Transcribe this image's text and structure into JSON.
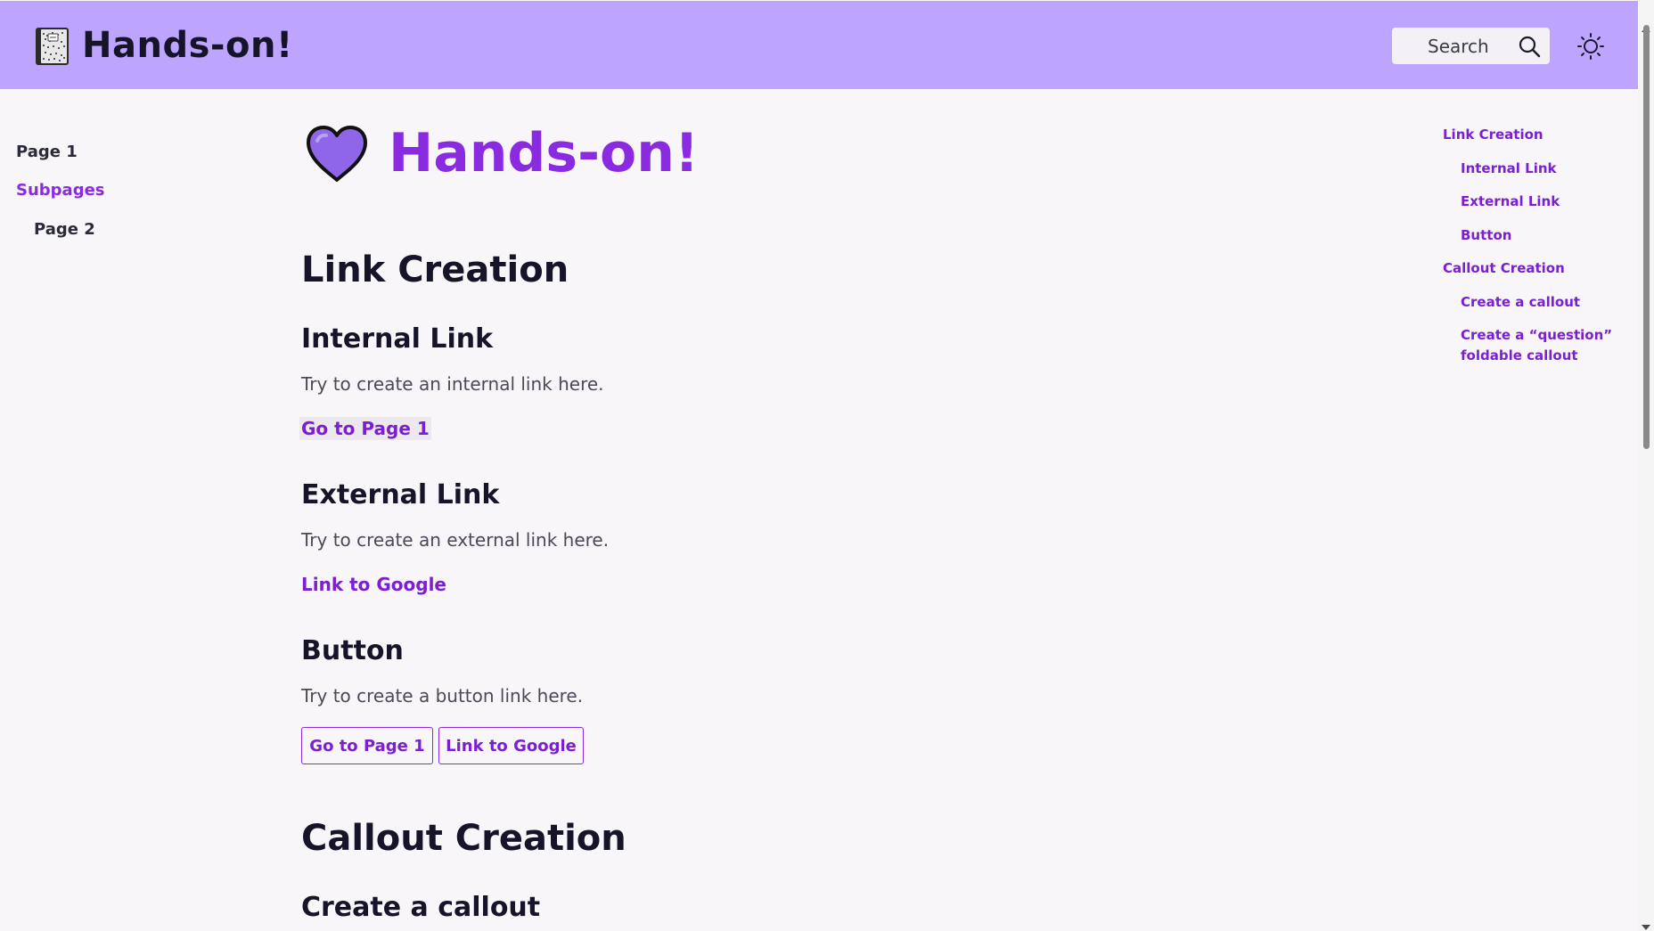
{
  "header": {
    "title": "Hands-on!",
    "search_placeholder": "Search",
    "logo_icon": "notebook-icon",
    "theme_icon": "sun-icon",
    "background": "#bca4ff"
  },
  "left_nav": {
    "items": [
      {
        "label": "Page 1"
      },
      {
        "label": "Subpages"
      },
      {
        "label": "Page 2"
      }
    ]
  },
  "main": {
    "title": "Hands-on!",
    "title_icon": "purple-heart-icon",
    "sections": [
      {
        "heading": "Link Creation",
        "subsections": [
          {
            "heading": "Internal Link",
            "text": "Try to create an internal link here.",
            "link": "Go to Page 1"
          },
          {
            "heading": "External Link",
            "text": "Try to create an external link here.",
            "link": "Link to Google"
          },
          {
            "heading": "Button",
            "text": "Try to create a button link here.",
            "buttons": [
              "Go to Page 1",
              "Link to Google"
            ]
          }
        ]
      },
      {
        "heading": "Callout Creation",
        "subsections": [
          {
            "heading": "Create a callout"
          }
        ]
      }
    ]
  },
  "toc": {
    "items": [
      {
        "label": "Link Creation"
      },
      {
        "label": "Internal Link"
      },
      {
        "label": "External Link"
      },
      {
        "label": "Button"
      },
      {
        "label": "Callout Creation"
      },
      {
        "label": "Create a callout"
      },
      {
        "label": "Create a “question” foldable callout",
        "line1": "Create a “question”",
        "line2": "foldable callout"
      }
    ]
  },
  "colors": {
    "accent": "#8a2be2",
    "link": "#7a20d0",
    "page_bg": "#f9f6f9",
    "heading": "#161428"
  }
}
